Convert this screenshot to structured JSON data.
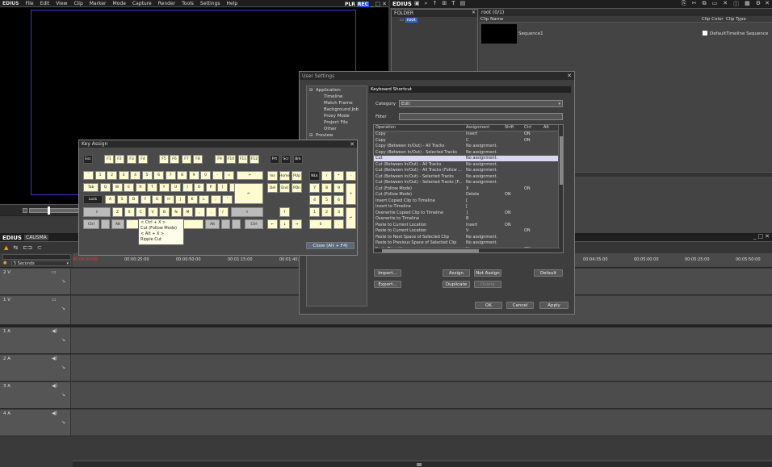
{
  "menubar": {
    "brand": "EDIUS",
    "items": [
      "File",
      "Edit",
      "View",
      "Clip",
      "Marker",
      "Mode",
      "Capture",
      "Render",
      "Tools",
      "Settings",
      "Help"
    ],
    "plr": "PLR",
    "rec": "REC"
  },
  "bin": {
    "brand": "EDIUS",
    "folder_header": "FOLDER",
    "root_folder": "root",
    "path": "root (0/1)",
    "columns": {
      "clip_name": "Clip Name",
      "clip_color": "Clip Color",
      "clip_type": "Clip Type"
    },
    "clip": {
      "name": "Sequence1",
      "default": "Default",
      "type": "Timeline Sequence"
    }
  },
  "timeline": {
    "brand": "EDIUS",
    "sequence": "CAUSMA",
    "scale": "5 Seconds",
    "ruler_left": [
      "00:00:00:00",
      "00:00:25:00",
      "00:00:50:00",
      "00:01:15:00",
      "00:01:40:00"
    ],
    "ruler_right": [
      "00:04:35:00",
      "00:05:00:00",
      "00:05:25:00",
      "00:05:50:00"
    ],
    "tracks": [
      {
        "name": "2 V",
        "type": "video"
      },
      {
        "name": "1 V",
        "type": "video"
      },
      {
        "name": "1 A",
        "type": "audio"
      },
      {
        "name": "2 A",
        "type": "audio"
      },
      {
        "name": "3 A",
        "type": "audio"
      },
      {
        "name": "4 A",
        "type": "audio"
      }
    ]
  },
  "user_settings": {
    "title": "User Settings",
    "tree": [
      {
        "label": "Application",
        "indent": 0
      },
      {
        "label": "Timeline",
        "indent": 1
      },
      {
        "label": "Match Frame",
        "indent": 1
      },
      {
        "label": "Background Job",
        "indent": 1
      },
      {
        "label": "Proxy Mode",
        "indent": 1
      },
      {
        "label": "Project File",
        "indent": 1
      },
      {
        "label": "Other",
        "indent": 1
      },
      {
        "label": "Preview",
        "indent": 0
      }
    ],
    "section_title": "Keyboard Shortcut",
    "category_label": "Category",
    "category_value": "Edit",
    "filter_label": "Filter",
    "columns": [
      "Operation",
      "Assignment",
      "Shift",
      "Ctrl",
      "Alt"
    ],
    "rows": [
      {
        "op": "Copy",
        "assign": "Insert",
        "shift": "",
        "ctrl": "ON",
        "alt": ""
      },
      {
        "op": "Copy",
        "assign": "C",
        "shift": "",
        "ctrl": "ON",
        "alt": ""
      },
      {
        "op": "Copy (Between In/Out) - All Tracks",
        "assign": "No assignment.",
        "shift": "",
        "ctrl": "",
        "alt": ""
      },
      {
        "op": "Copy (Between In/Out) - Selected Tracks",
        "assign": "No assignment.",
        "shift": "",
        "ctrl": "",
        "alt": ""
      },
      {
        "op": "Cut",
        "assign": "No assignment.",
        "shift": "",
        "ctrl": "",
        "alt": "",
        "selected": true
      },
      {
        "op": "Cut (Between In/Out) - All Tracks",
        "assign": "No assignment.",
        "shift": "",
        "ctrl": "",
        "alt": ""
      },
      {
        "op": "Cut (Between In/Out) - All Tracks (Follow ...",
        "assign": "No assignment.",
        "shift": "",
        "ctrl": "",
        "alt": ""
      },
      {
        "op": "Cut (Between In/Out) - Selected Tracks",
        "assign": "No assignment.",
        "shift": "",
        "ctrl": "",
        "alt": ""
      },
      {
        "op": "Cut (Between In/Out) - Selected Tracks (F...",
        "assign": "No assignment.",
        "shift": "",
        "ctrl": "",
        "alt": ""
      },
      {
        "op": "Cut (Follow Mode)",
        "assign": "X",
        "shift": "",
        "ctrl": "ON",
        "alt": ""
      },
      {
        "op": "Cut (Follow Mode)",
        "assign": "Delete",
        "shift": "ON",
        "ctrl": "",
        "alt": ""
      },
      {
        "op": "Insert Copied Clip to Timeline",
        "assign": "[",
        "shift": "",
        "ctrl": "",
        "alt": ""
      },
      {
        "op": "Insert to Timeline",
        "assign": "[",
        "shift": "",
        "ctrl": "",
        "alt": ""
      },
      {
        "op": "Overwrite Copied Clip to Timeline",
        "assign": "]",
        "shift": "ON",
        "ctrl": "",
        "alt": ""
      },
      {
        "op": "Overwrite to Timeline",
        "assign": "B",
        "shift": "",
        "ctrl": "",
        "alt": ""
      },
      {
        "op": "Paste to Current Location",
        "assign": "Insert",
        "shift": "ON",
        "ctrl": "",
        "alt": ""
      },
      {
        "op": "Paste to Current Location",
        "assign": "V",
        "shift": "",
        "ctrl": "ON",
        "alt": ""
      },
      {
        "op": "Paste to Next Space of Selected Clip",
        "assign": "No assignment.",
        "shift": "",
        "ctrl": "",
        "alt": ""
      },
      {
        "op": "Paste to Previous Space of Selected Clip",
        "assign": "No assignment.",
        "shift": "",
        "ctrl": "",
        "alt": ""
      },
      {
        "op": "Paste Transition",
        "assign": "K",
        "shift": "",
        "ctrl": "ON",
        "alt": ""
      }
    ],
    "buttons": {
      "import": "Import...",
      "export": "Export...",
      "assign": "Assign",
      "not_assign": "Not Assign",
      "duplicate": "Duplicate",
      "delete": "Delete",
      "default": "Default",
      "ok": "OK",
      "cancel": "Cancel",
      "apply": "Apply"
    }
  },
  "key_assign": {
    "title": "Key Assign",
    "close_label": "Close (Alt + F4)",
    "tooltip": [
      "< Ctrl + X >",
      "Cut (Follow Mode)",
      "< Alt + X >",
      "Ripple Cut"
    ],
    "fkeys": [
      "Esc",
      "F1",
      "F2",
      "F3",
      "F4",
      "F5",
      "F6",
      "F7",
      "F8",
      "F9",
      "F10",
      "F11",
      "F12",
      "Prt",
      "Scr",
      "Brk"
    ],
    "row1": [
      "`",
      "1",
      "2",
      "3",
      "4",
      "5",
      "6",
      "7",
      "8",
      "9",
      "0",
      "-",
      "="
    ],
    "row2": [
      "Q",
      "W",
      "E",
      "R",
      "T",
      "Y",
      "U",
      "I",
      "O",
      "P",
      "[",
      "]"
    ],
    "row3": [
      "A",
      "S",
      "D",
      "F",
      "G",
      "H",
      "J",
      "K",
      "L",
      ";",
      "'"
    ],
    "row4": [
      "Z",
      "X",
      "C",
      "V",
      "B",
      "N",
      "M",
      ",",
      ".",
      "/"
    ],
    "nav": [
      "Ins",
      "Home",
      "PUp",
      "Del",
      "End",
      "PDn"
    ],
    "numpad": [
      "NLk",
      "/",
      "*",
      "-",
      "7",
      "8",
      "9",
      "+",
      "4",
      "5",
      "6",
      "1",
      "2",
      "3",
      "0",
      "."
    ],
    "labels": {
      "tab": "Tab",
      "caps": "Lock",
      "ctrl": "Ctrl",
      "alt": "Alt",
      "backspace": "←",
      "enter": "↵",
      "shift": "⇧"
    }
  }
}
